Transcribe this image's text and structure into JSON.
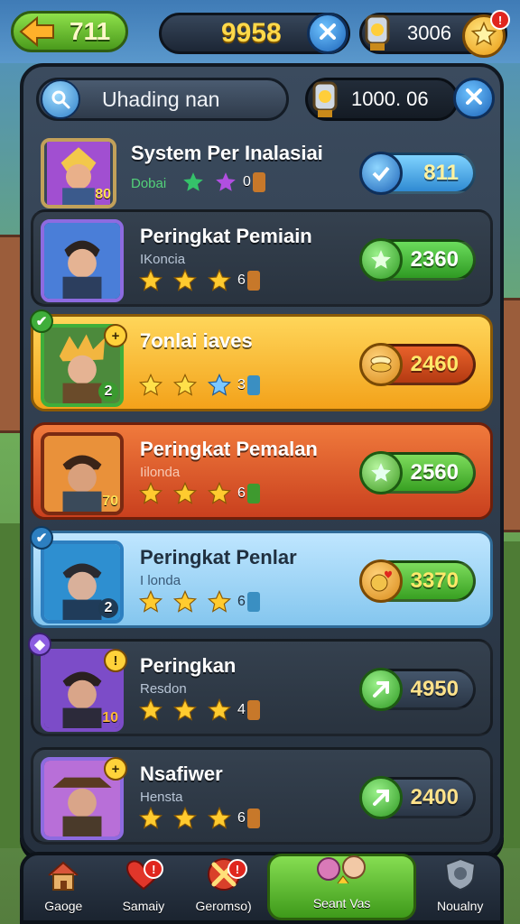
{
  "header": {
    "back_value": "711",
    "coins": "9958",
    "gems": "3006",
    "star_badge": "!"
  },
  "panel": {
    "search_text": "Uhading nan",
    "ticket_value": "1000. 06"
  },
  "rows": [
    {
      "name": "System Per Inalasiai",
      "sub": "Dobai",
      "rank": "0",
      "score": "811",
      "level": "80",
      "style": "plain"
    },
    {
      "name": "Peringkat Pemiain",
      "sub": "IKoncia",
      "rank": "6",
      "score": "2360",
      "level": "",
      "style": "dark"
    },
    {
      "name": "7onlai iaves",
      "sub": "",
      "rank": "3",
      "score": "2460",
      "level": "2",
      "style": "gold"
    },
    {
      "name": "Peringkat Pemalan",
      "sub": "Iilonda",
      "rank": "6",
      "score": "2560",
      "level": "70",
      "style": "red"
    },
    {
      "name": "Peringkat Penlar",
      "sub": "I londa",
      "rank": "6",
      "score": "3370",
      "level": "2",
      "style": "blue"
    },
    {
      "name": "Peringkan",
      "sub": "Resdon",
      "rank": "4",
      "score": "4950",
      "level": "10",
      "style": "dark"
    },
    {
      "name": "Nsafiwer",
      "sub": "Hensta",
      "rank": "6",
      "score": "2400",
      "level": "",
      "style": "dark"
    }
  ],
  "nav": [
    {
      "label": "Gaoge",
      "icon": "house-icon"
    },
    {
      "label": "Samaiy",
      "icon": "heart-icon",
      "badge": "!"
    },
    {
      "label": "Geromso)",
      "icon": "crossed-swords-icon",
      "badge": "!"
    },
    {
      "label": "Seant Vas",
      "icon": "friends-icon",
      "active": true
    },
    {
      "label": "Noualny",
      "icon": "shield-icon"
    }
  ],
  "colors": {
    "accent_green": "#4a9a1c",
    "gold": "#ffd65a",
    "panel": "#2c3847"
  }
}
